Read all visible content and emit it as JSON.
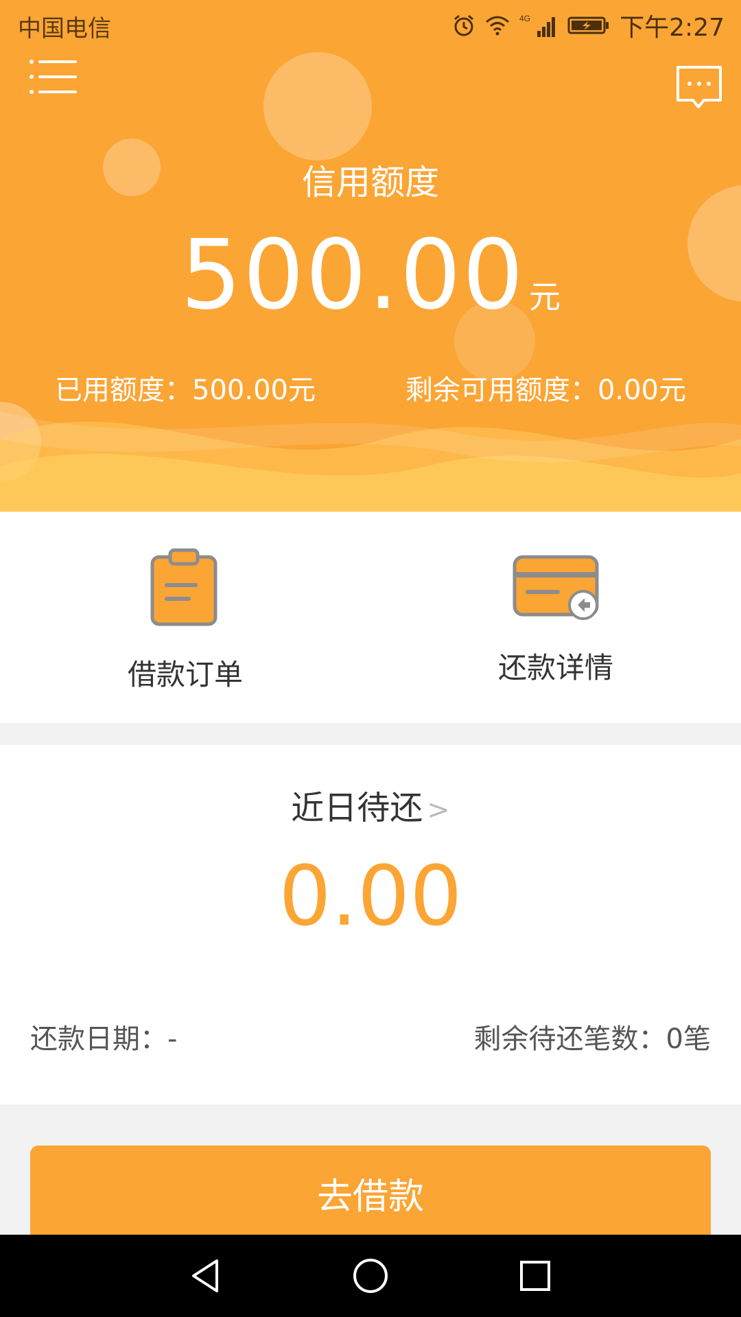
{
  "status_bar": {
    "carrier": "中国电信",
    "time": "下午2:27",
    "network": "4G"
  },
  "header": {
    "credit_label": "信用额度",
    "credit_amount": "500.00",
    "credit_unit": "元",
    "used_label": "已用额度：",
    "used_value": "500.00元",
    "remain_label": "剩余可用额度：",
    "remain_value": "0.00元"
  },
  "actions": [
    {
      "label": "借款订单",
      "icon": "clipboard-icon"
    },
    {
      "label": "还款详情",
      "icon": "card-repay-icon"
    }
  ],
  "pending": {
    "title": "近日待还",
    "chevron": ">",
    "amount": "0.00",
    "repay_date_label": "还款日期：",
    "repay_date_value": "-",
    "remain_count_label": "剩余待还笔数：",
    "remain_count_value": "0笔"
  },
  "borrow_button": "去借款",
  "colors": {
    "accent": "#fba535",
    "background": "#f2f2f2",
    "nav": "#000000"
  }
}
